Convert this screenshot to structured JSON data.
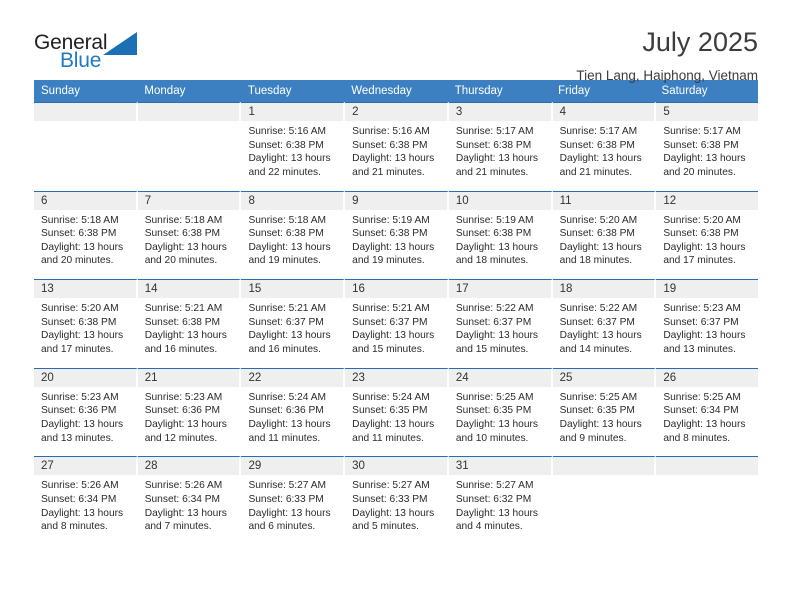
{
  "brand": {
    "name_top": "General",
    "name_bottom": "Blue",
    "accent_color": "#1f7ac4"
  },
  "header": {
    "month_title": "July 2025",
    "location": "Tien Lang, Haiphong, Vietnam"
  },
  "calendar": {
    "header_color": "#3c80c2",
    "weekdays": [
      "Sunday",
      "Monday",
      "Tuesday",
      "Wednesday",
      "Thursday",
      "Friday",
      "Saturday"
    ],
    "weeks": [
      [
        {
          "day": "",
          "lines": []
        },
        {
          "day": "",
          "lines": []
        },
        {
          "day": "1",
          "lines": [
            "Sunrise: 5:16 AM",
            "Sunset: 6:38 PM",
            "Daylight: 13 hours",
            "and 22 minutes."
          ]
        },
        {
          "day": "2",
          "lines": [
            "Sunrise: 5:16 AM",
            "Sunset: 6:38 PM",
            "Daylight: 13 hours",
            "and 21 minutes."
          ]
        },
        {
          "day": "3",
          "lines": [
            "Sunrise: 5:17 AM",
            "Sunset: 6:38 PM",
            "Daylight: 13 hours",
            "and 21 minutes."
          ]
        },
        {
          "day": "4",
          "lines": [
            "Sunrise: 5:17 AM",
            "Sunset: 6:38 PM",
            "Daylight: 13 hours",
            "and 21 minutes."
          ]
        },
        {
          "day": "5",
          "lines": [
            "Sunrise: 5:17 AM",
            "Sunset: 6:38 PM",
            "Daylight: 13 hours",
            "and 20 minutes."
          ]
        }
      ],
      [
        {
          "day": "6",
          "lines": [
            "Sunrise: 5:18 AM",
            "Sunset: 6:38 PM",
            "Daylight: 13 hours",
            "and 20 minutes."
          ]
        },
        {
          "day": "7",
          "lines": [
            "Sunrise: 5:18 AM",
            "Sunset: 6:38 PM",
            "Daylight: 13 hours",
            "and 20 minutes."
          ]
        },
        {
          "day": "8",
          "lines": [
            "Sunrise: 5:18 AM",
            "Sunset: 6:38 PM",
            "Daylight: 13 hours",
            "and 19 minutes."
          ]
        },
        {
          "day": "9",
          "lines": [
            "Sunrise: 5:19 AM",
            "Sunset: 6:38 PM",
            "Daylight: 13 hours",
            "and 19 minutes."
          ]
        },
        {
          "day": "10",
          "lines": [
            "Sunrise: 5:19 AM",
            "Sunset: 6:38 PM",
            "Daylight: 13 hours",
            "and 18 minutes."
          ]
        },
        {
          "day": "11",
          "lines": [
            "Sunrise: 5:20 AM",
            "Sunset: 6:38 PM",
            "Daylight: 13 hours",
            "and 18 minutes."
          ]
        },
        {
          "day": "12",
          "lines": [
            "Sunrise: 5:20 AM",
            "Sunset: 6:38 PM",
            "Daylight: 13 hours",
            "and 17 minutes."
          ]
        }
      ],
      [
        {
          "day": "13",
          "lines": [
            "Sunrise: 5:20 AM",
            "Sunset: 6:38 PM",
            "Daylight: 13 hours",
            "and 17 minutes."
          ]
        },
        {
          "day": "14",
          "lines": [
            "Sunrise: 5:21 AM",
            "Sunset: 6:38 PM",
            "Daylight: 13 hours",
            "and 16 minutes."
          ]
        },
        {
          "day": "15",
          "lines": [
            "Sunrise: 5:21 AM",
            "Sunset: 6:37 PM",
            "Daylight: 13 hours",
            "and 16 minutes."
          ]
        },
        {
          "day": "16",
          "lines": [
            "Sunrise: 5:21 AM",
            "Sunset: 6:37 PM",
            "Daylight: 13 hours",
            "and 15 minutes."
          ]
        },
        {
          "day": "17",
          "lines": [
            "Sunrise: 5:22 AM",
            "Sunset: 6:37 PM",
            "Daylight: 13 hours",
            "and 15 minutes."
          ]
        },
        {
          "day": "18",
          "lines": [
            "Sunrise: 5:22 AM",
            "Sunset: 6:37 PM",
            "Daylight: 13 hours",
            "and 14 minutes."
          ]
        },
        {
          "day": "19",
          "lines": [
            "Sunrise: 5:23 AM",
            "Sunset: 6:37 PM",
            "Daylight: 13 hours",
            "and 13 minutes."
          ]
        }
      ],
      [
        {
          "day": "20",
          "lines": [
            "Sunrise: 5:23 AM",
            "Sunset: 6:36 PM",
            "Daylight: 13 hours",
            "and 13 minutes."
          ]
        },
        {
          "day": "21",
          "lines": [
            "Sunrise: 5:23 AM",
            "Sunset: 6:36 PM",
            "Daylight: 13 hours",
            "and 12 minutes."
          ]
        },
        {
          "day": "22",
          "lines": [
            "Sunrise: 5:24 AM",
            "Sunset: 6:36 PM",
            "Daylight: 13 hours",
            "and 11 minutes."
          ]
        },
        {
          "day": "23",
          "lines": [
            "Sunrise: 5:24 AM",
            "Sunset: 6:35 PM",
            "Daylight: 13 hours",
            "and 11 minutes."
          ]
        },
        {
          "day": "24",
          "lines": [
            "Sunrise: 5:25 AM",
            "Sunset: 6:35 PM",
            "Daylight: 13 hours",
            "and 10 minutes."
          ]
        },
        {
          "day": "25",
          "lines": [
            "Sunrise: 5:25 AM",
            "Sunset: 6:35 PM",
            "Daylight: 13 hours",
            "and 9 minutes."
          ]
        },
        {
          "day": "26",
          "lines": [
            "Sunrise: 5:25 AM",
            "Sunset: 6:34 PM",
            "Daylight: 13 hours",
            "and 8 minutes."
          ]
        }
      ],
      [
        {
          "day": "27",
          "lines": [
            "Sunrise: 5:26 AM",
            "Sunset: 6:34 PM",
            "Daylight: 13 hours",
            "and 8 minutes."
          ]
        },
        {
          "day": "28",
          "lines": [
            "Sunrise: 5:26 AM",
            "Sunset: 6:34 PM",
            "Daylight: 13 hours",
            "and 7 minutes."
          ]
        },
        {
          "day": "29",
          "lines": [
            "Sunrise: 5:27 AM",
            "Sunset: 6:33 PM",
            "Daylight: 13 hours",
            "and 6 minutes."
          ]
        },
        {
          "day": "30",
          "lines": [
            "Sunrise: 5:27 AM",
            "Sunset: 6:33 PM",
            "Daylight: 13 hours",
            "and 5 minutes."
          ]
        },
        {
          "day": "31",
          "lines": [
            "Sunrise: 5:27 AM",
            "Sunset: 6:32 PM",
            "Daylight: 13 hours",
            "and 4 minutes."
          ]
        },
        {
          "day": "",
          "lines": []
        },
        {
          "day": "",
          "lines": []
        }
      ]
    ]
  }
}
